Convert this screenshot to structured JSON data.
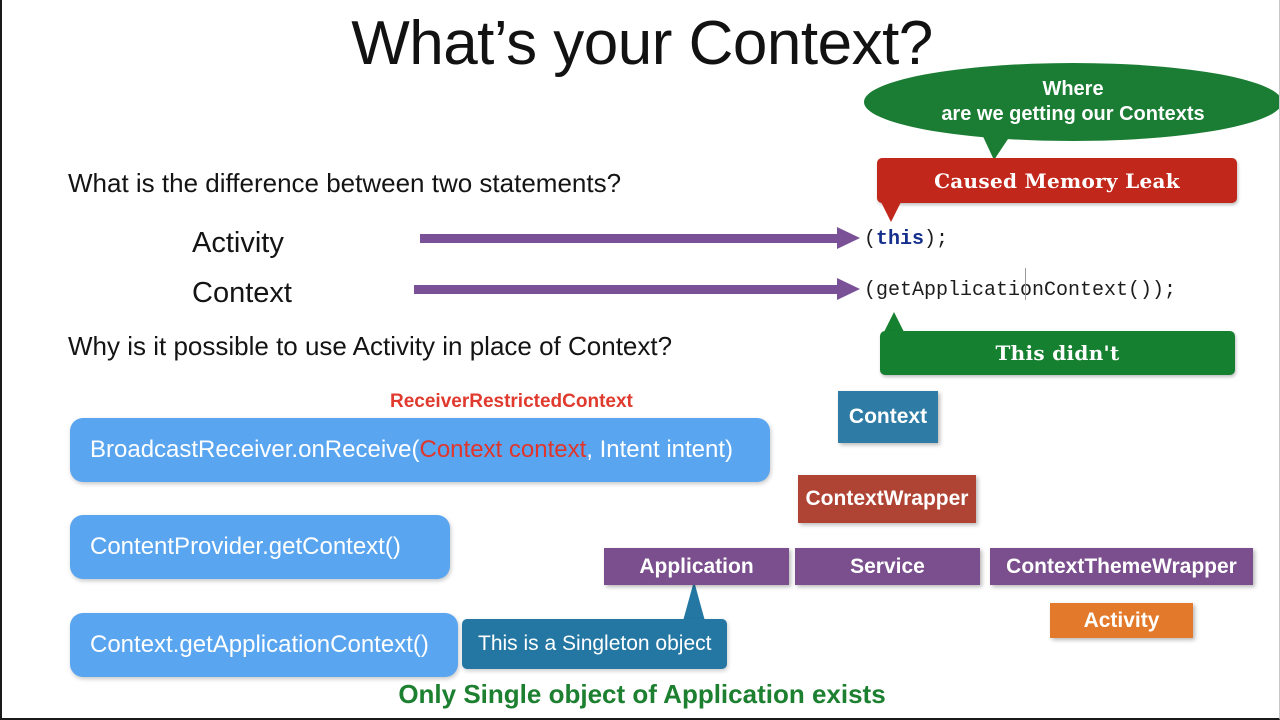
{
  "slide": {
    "title": "What’s your Context?",
    "background_color": "#ffffff"
  },
  "questions": {
    "q1": "What is the difference between two statements?",
    "q2": "Why is it possible to use Activity in place of Context?"
  },
  "comparison": {
    "row1_label": "Activity",
    "row2_label": "Context",
    "arrow_color": "#7a5196"
  },
  "code": {
    "line1_open": "(",
    "line1_keyword": "this",
    "line1_close": ");",
    "line1_keyword_color": "#152f8c",
    "line2": "(getApplicationContext());"
  },
  "callouts": {
    "where_line1": "Where",
    "where_line2": "are we getting our Contexts",
    "where_color": "#1a7d33",
    "memory_leak": "Caused Memory Leak",
    "memory_leak_color": "#c1271b",
    "this_didnt": "This didn't",
    "this_didnt_color": "#15802f"
  },
  "annotations": {
    "receiver_restricted_context": "ReceiverRestrictedContext",
    "receiver_restricted_context_color": "#e03a2f",
    "singleton_note": "This is a Singleton object",
    "singleton_note_color": "#2477a3",
    "bottom_note": "Only Single object of Application exists",
    "bottom_note_color": "#1d8030"
  },
  "api_boxes": [
    {
      "id": "broadcast-receiver",
      "prefix": "BroadcastReceiver.onReceive(",
      "highlight": "Context context",
      "suffix": ", Intent intent)",
      "color": "#59a5f0",
      "highlight_color": "#e0352b"
    },
    {
      "id": "content-provider",
      "label": "ContentProvider.getContext()",
      "color": "#59a5f0"
    },
    {
      "id": "context-get-application-context",
      "label": "Context.getApplicationContext()",
      "color": "#59a5f0"
    }
  ],
  "hierarchy": {
    "nodes": [
      {
        "label": "Context",
        "color": "#2e7ca5",
        "level": 0
      },
      {
        "label": "ContextWrapper",
        "color": "#b04434",
        "level": 1
      },
      {
        "label": "Application",
        "color": "#7b4e8e",
        "level": 2
      },
      {
        "label": "Service",
        "color": "#7b4e8e",
        "level": 2
      },
      {
        "label": "ContextThemeWrapper",
        "color": "#7b4e8e",
        "level": 2
      },
      {
        "label": "Activity",
        "color": "#e3792a",
        "level": 3
      }
    ]
  }
}
